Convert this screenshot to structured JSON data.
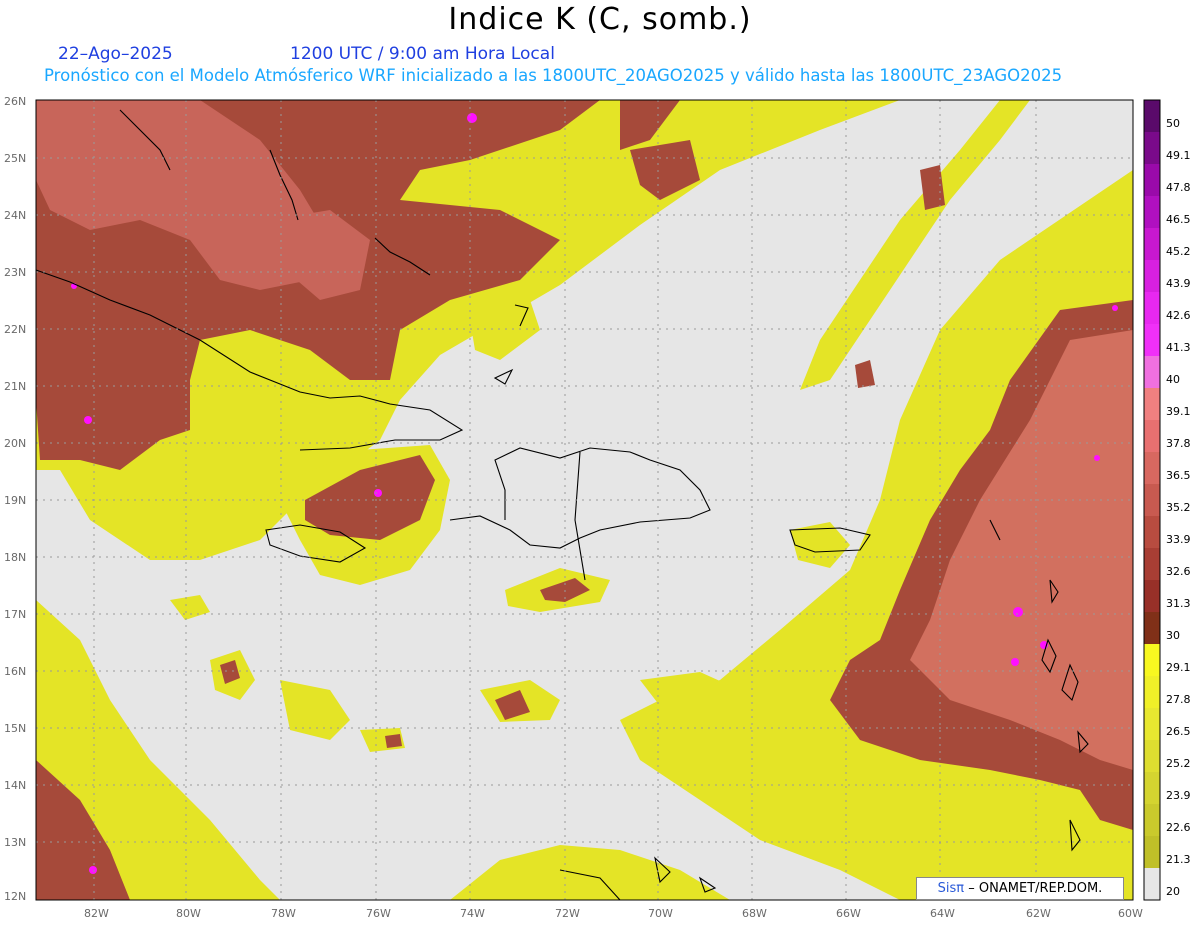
{
  "header": {
    "title": "Indice K (C, somb.)",
    "date": "22–Ago–2025",
    "time": "1200 UTC / 9:00 am Hora Local",
    "model_info": "Pronóstico con el Modelo Atmósferico WRF inicializado a las 1800UTC_20AGO2025 y válido hasta las  1800UTC_23AGO2025"
  },
  "axes": {
    "lat_labels": [
      "26N",
      "25N",
      "24N",
      "23N",
      "22N",
      "21N",
      "20N",
      "19N",
      "18N",
      "17N",
      "16N",
      "15N",
      "14N",
      "13N",
      "12N"
    ],
    "lon_labels": [
      "82W",
      "80W",
      "78W",
      "76W",
      "74W",
      "72W",
      "70W",
      "68W",
      "66W",
      "64W",
      "62W",
      "60W"
    ]
  },
  "colorbar": {
    "labels": [
      "50",
      "49.1",
      "47.8",
      "46.5",
      "45.2",
      "43.9",
      "42.6",
      "41.3",
      "40",
      "39.1",
      "37.8",
      "36.5",
      "35.2",
      "33.9",
      "32.6",
      "31.3",
      "30",
      "29.1",
      "27.8",
      "26.5",
      "25.2",
      "23.9",
      "22.6",
      "21.3",
      "20"
    ],
    "colors": [
      "#5a0a6a",
      "#7a0a8a",
      "#9a0aaa",
      "#b010c0",
      "#c818d0",
      "#d820e0",
      "#e828f0",
      "#f030f8",
      "#f070e0",
      "#f08080",
      "#e87070",
      "#d86860",
      "#c85a50",
      "#b84c40",
      "#a83e34",
      "#983028",
      "#803018",
      "#f8f820",
      "#f0f028",
      "#e8e830",
      "#dede30",
      "#d4d430",
      "#caca2c",
      "#c0c028",
      "#e6e6e6"
    ]
  },
  "credit": {
    "sis": "Sisπ",
    "rest": "– ONAMET/REP.DOM."
  },
  "map_colors": {
    "background": "#e6e6e6",
    "yellow": "#e6e624",
    "brown": "#a64a3a",
    "salmon": "#d27060",
    "magenta": "#ff10ff"
  }
}
